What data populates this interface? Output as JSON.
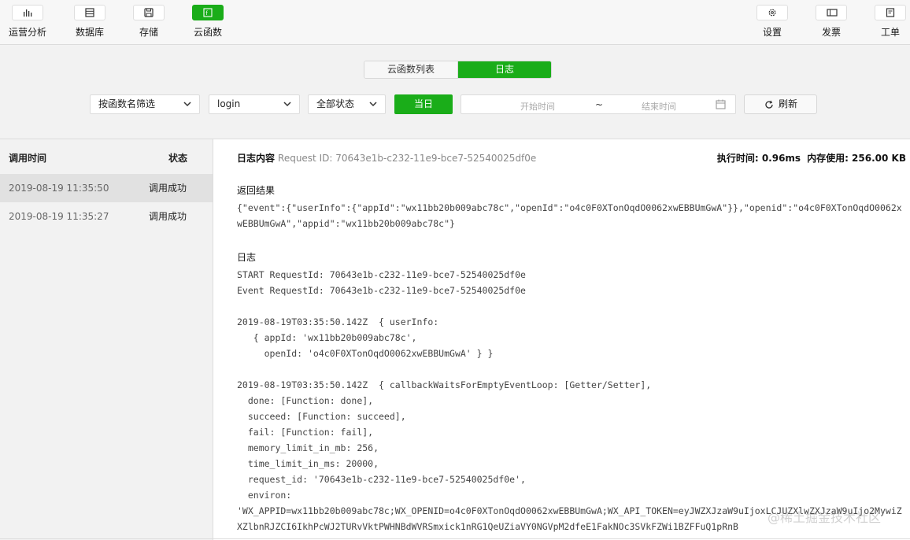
{
  "toolbar": {
    "left": [
      {
        "label": "运营分析",
        "icon": "bar-chart-icon"
      },
      {
        "label": "数据库",
        "icon": "database-icon"
      },
      {
        "label": "存储",
        "icon": "storage-icon"
      },
      {
        "label": "云函数",
        "icon": "cloud-function-icon",
        "active": true
      }
    ],
    "right": [
      {
        "label": "设置",
        "icon": "gear-icon"
      },
      {
        "label": "发票",
        "icon": "invoice-icon"
      },
      {
        "label": "工单",
        "icon": "ticket-icon"
      }
    ]
  },
  "tabs": {
    "list": "云函数列表",
    "log": "日志",
    "active": "日志"
  },
  "filters": {
    "filter_by": "按函数名筛选",
    "function_name": "login",
    "status": "全部状态",
    "today": "当日",
    "start_placeholder": "开始时间",
    "separator": "~",
    "end_placeholder": "结束时间",
    "refresh": "刷新"
  },
  "list": {
    "col_time": "调用时间",
    "col_status": "状态",
    "rows": [
      {
        "time": "2019-08-19 11:35:50",
        "status": "调用成功",
        "selected": true
      },
      {
        "time": "2019-08-19 11:35:27",
        "status": "调用成功",
        "selected": false
      }
    ]
  },
  "detail": {
    "title": "日志内容",
    "request_id": "Request ID: 70643e1b-c232-11e9-bce7-52540025df0e",
    "exec_time": "执行时间: 0.96ms",
    "memory": "内存使用: 256.00 KB",
    "result_label": "返回结果",
    "result_text": "{\"event\":{\"userInfo\":{\"appId\":\"wx11bb20b009abc78c\",\"openId\":\"o4c0F0XTonOqdO0062xwEBBUmGwA\"}},\"openid\":\"o4c0F0XTonOqdO0062xwEBBUmGwA\",\"appid\":\"wx11bb20b009abc78c\"}",
    "log_label": "日志",
    "log_line1": "START RequestId: 70643e1b-c232-11e9-bce7-52540025df0e",
    "log_line2": "Event RequestId: 70643e1b-c232-11e9-bce7-52540025df0e",
    "log_block1": "2019-08-19T03:35:50.142Z  { userInfo:\n   { appId: 'wx11bb20b009abc78c',\n     openId: 'o4c0F0XTonOqdO0062xwEBBUmGwA' } }",
    "log_block2": "2019-08-19T03:35:50.142Z  { callbackWaitsForEmptyEventLoop: [Getter/Setter],\n  done: [Function: done],\n  succeed: [Function: succeed],\n  fail: [Function: fail],\n  memory_limit_in_mb: 256,\n  time_limit_in_ms: 20000,\n  request_id: '70643e1b-c232-11e9-bce7-52540025df0e',\n  environ:",
    "environ_text": "'WX_APPID=wx11bb20b009abc78c;WX_OPENID=o4c0F0XTonOqdO0062xwEBBUmGwA;WX_API_TOKEN=eyJWZXJzaW9uIjoxLCJUZXlwZXJzaW9uIjo2MywiZXZlbnRJZCI6IkhPcWJ2TURvVktPWHNBdWVRSmxick1nRG1QeUZiaVY0NGVpM2dfeE1FakNOc3SVkFZWi1BZFFuQ1pRnB"
  },
  "watermark": "@稀土掘金技术社区"
}
